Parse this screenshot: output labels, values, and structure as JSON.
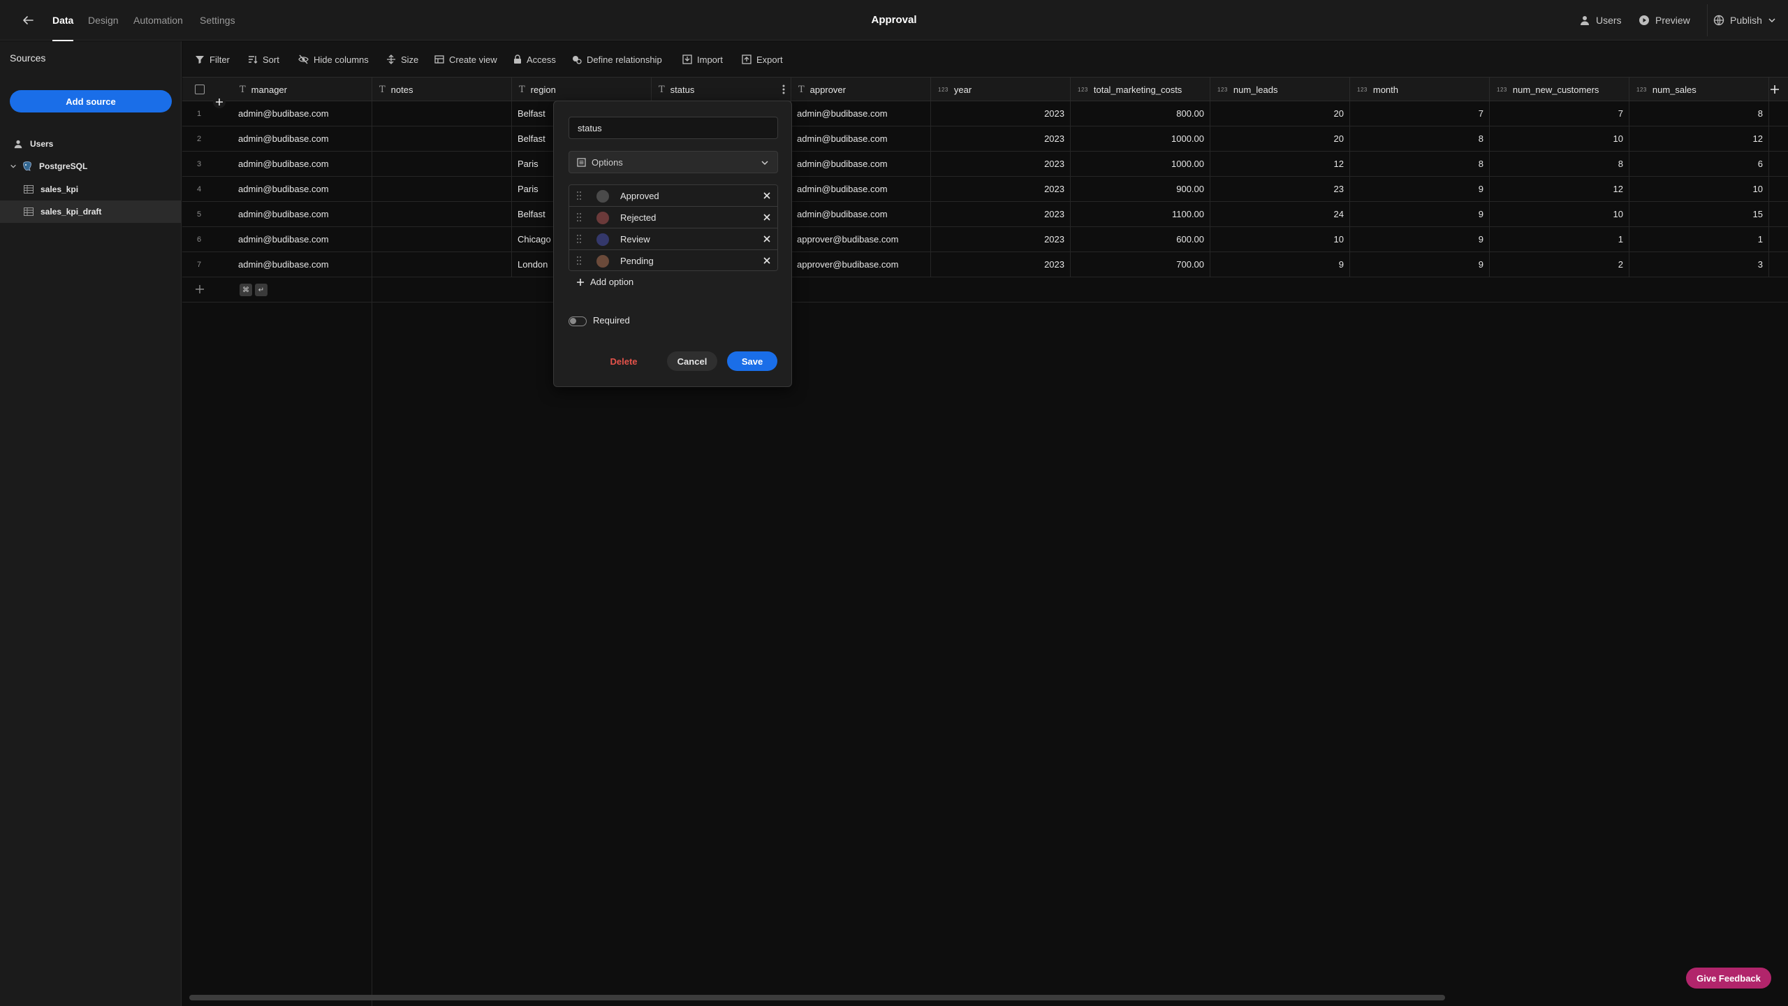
{
  "app": {
    "title": "Approval"
  },
  "nav": {
    "tabs": [
      "Data",
      "Design",
      "Automation",
      "Settings"
    ],
    "active": "Data"
  },
  "header_right": {
    "users": "Users",
    "preview": "Preview",
    "publish": "Publish"
  },
  "sidebar": {
    "title": "Sources",
    "add_source": "Add source",
    "items": [
      {
        "label": "Users",
        "icon": "user-icon"
      },
      {
        "label": "PostgreSQL",
        "icon": "postgres-icon"
      },
      {
        "label": "sales_kpi",
        "icon": "table-icon"
      },
      {
        "label": "sales_kpi_draft",
        "icon": "table-icon"
      }
    ]
  },
  "toolbar": {
    "filter": "Filter",
    "sort": "Sort",
    "hide_columns": "Hide columns",
    "size": "Size",
    "create_view": "Create view",
    "access": "Access",
    "define_relationship": "Define relationship",
    "import": "Import",
    "export": "Export"
  },
  "table": {
    "columns": [
      {
        "name": "manager",
        "type": "text"
      },
      {
        "name": "notes",
        "type": "text"
      },
      {
        "name": "region",
        "type": "text"
      },
      {
        "name": "status",
        "type": "text"
      },
      {
        "name": "approver",
        "type": "text"
      },
      {
        "name": "year",
        "type": "number"
      },
      {
        "name": "total_marketing_costs",
        "type": "number"
      },
      {
        "name": "num_leads",
        "type": "number"
      },
      {
        "name": "month",
        "type": "number"
      },
      {
        "name": "num_new_customers",
        "type": "number"
      },
      {
        "name": "num_sales",
        "type": "number"
      }
    ],
    "number_type_label": "123",
    "rows": [
      [
        "1",
        "admin@budibase.com",
        "",
        "Belfast",
        "",
        "admin@budibase.com",
        "2023",
        "800.00",
        "20",
        "7",
        "7",
        "8"
      ],
      [
        "2",
        "admin@budibase.com",
        "",
        "Belfast",
        "",
        "admin@budibase.com",
        "2023",
        "1000.00",
        "20",
        "8",
        "10",
        "12"
      ],
      [
        "3",
        "admin@budibase.com",
        "",
        "Paris",
        "",
        "admin@budibase.com",
        "2023",
        "1000.00",
        "12",
        "8",
        "8",
        "6"
      ],
      [
        "4",
        "admin@budibase.com",
        "",
        "Paris",
        "",
        "admin@budibase.com",
        "2023",
        "900.00",
        "23",
        "9",
        "12",
        "10"
      ],
      [
        "5",
        "admin@budibase.com",
        "",
        "Belfast",
        "",
        "admin@budibase.com",
        "2023",
        "1100.00",
        "24",
        "9",
        "10",
        "15"
      ],
      [
        "6",
        "admin@budibase.com",
        "",
        "Chicago",
        "",
        "approver@budibase.com",
        "2023",
        "600.00",
        "10",
        "9",
        "1",
        "1"
      ],
      [
        "7",
        "admin@budibase.com",
        "",
        "London",
        "",
        "approver@budibase.com",
        "2023",
        "700.00",
        "9",
        "9",
        "2",
        "3"
      ]
    ],
    "shortcut_keys": [
      "⌘",
      "↵"
    ]
  },
  "popover": {
    "name_value": "status",
    "type_label": "Options",
    "options": [
      {
        "label": "Approved",
        "color": "#4a4a4a"
      },
      {
        "label": "Rejected",
        "color": "#6b3a3a"
      },
      {
        "label": "Review",
        "color": "#34386b"
      },
      {
        "label": "Pending",
        "color": "#6b4a3a"
      }
    ],
    "add_option": "Add option",
    "required_label": "Required",
    "required": false,
    "delete": "Delete",
    "cancel": "Cancel",
    "save": "Save"
  },
  "feedback": "Give Feedback",
  "colors": {
    "accent": "#1a6ee8",
    "danger": "#e5534b",
    "feedback": "#b1256b"
  }
}
